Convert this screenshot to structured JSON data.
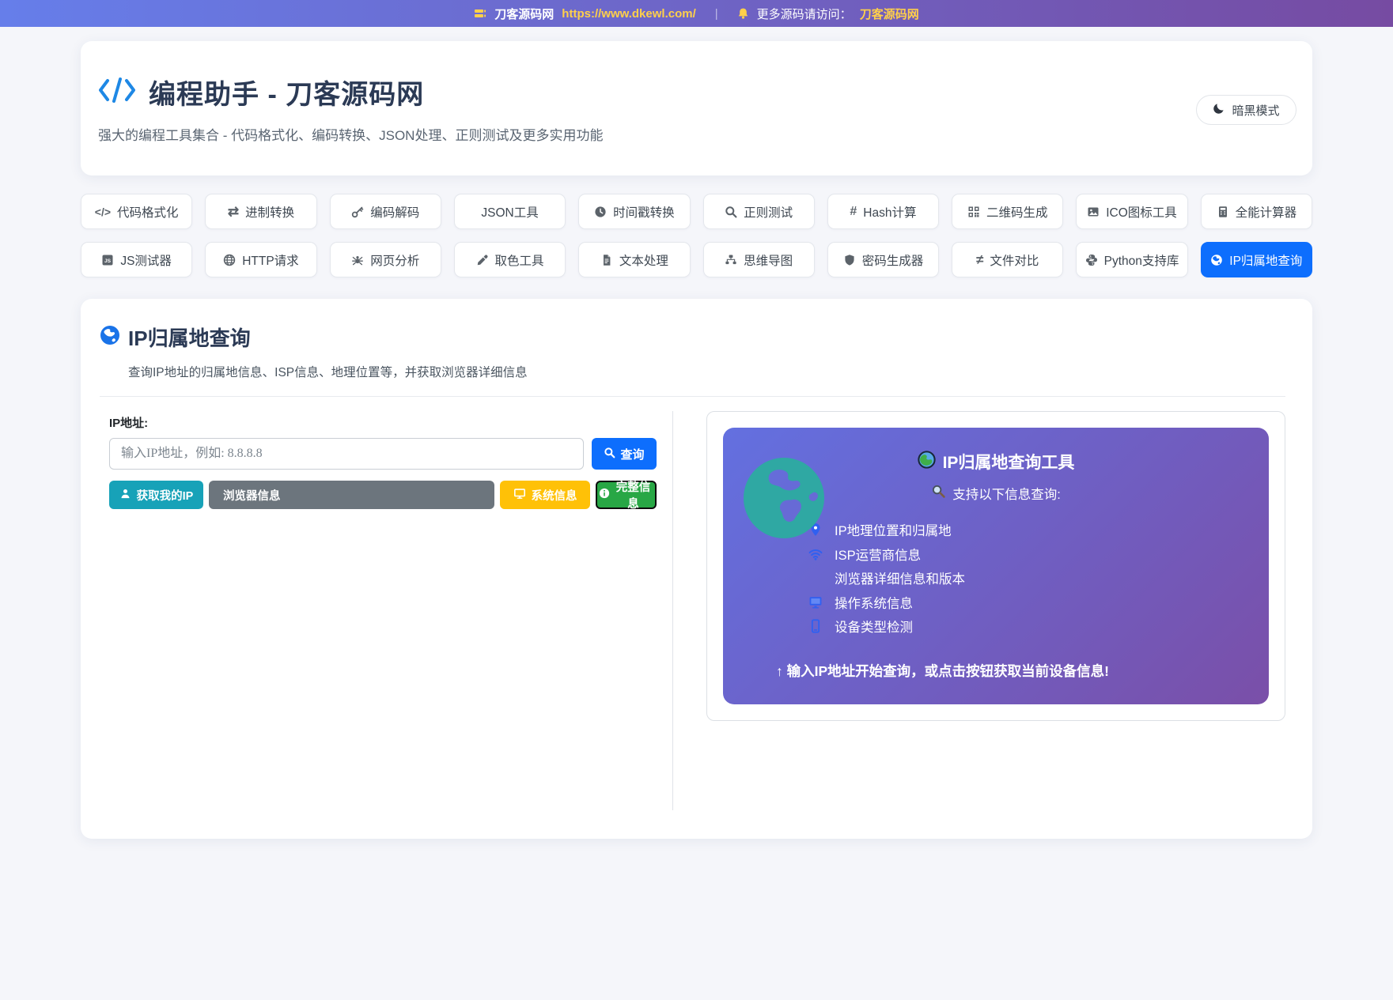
{
  "topbar": {
    "site_name": "刀客源码网",
    "url": "https://www.dkewl.com/",
    "divider": "|",
    "notice": "更多源码请访问：",
    "notice_link": "刀客源码网"
  },
  "header": {
    "title": "编程助手 - 刀客源码网",
    "subtitle": "强大的编程工具集合 - 代码格式化、编码转换、JSON处理、正则测试及更多实用功能",
    "dark_mode_label": "暗黑模式"
  },
  "nav": {
    "active": "IP归属地查询",
    "items": [
      {
        "label": "代码格式化",
        "glyph": "</>"
      },
      {
        "label": "进制转换",
        "glyph": "⇄"
      },
      {
        "label": "编码解码"
      },
      {
        "label": "JSON工具"
      },
      {
        "label": "时间戳转换"
      },
      {
        "label": "正则测试"
      },
      {
        "label": "Hash计算",
        "glyph": "#"
      },
      {
        "label": "二维码生成"
      },
      {
        "label": "ICO图标工具"
      },
      {
        "label": "全能计算器"
      },
      {
        "label": "JS测试器"
      },
      {
        "label": "HTTP请求"
      },
      {
        "label": "网页分析"
      },
      {
        "label": "取色工具"
      },
      {
        "label": "文本处理"
      },
      {
        "label": "思维导图"
      },
      {
        "label": "密码生成器"
      },
      {
        "label": "文件对比",
        "glyph": "≠"
      },
      {
        "label": "Python支持库"
      },
      {
        "label": "IP归属地查询"
      }
    ]
  },
  "tool": {
    "title": "IP归属地查询",
    "subtitle": "查询IP地址的归属地信息、ISP信息、地理位置等，并获取浏览器详细信息",
    "form": {
      "ip_label": "IP地址:",
      "ip_placeholder": "输入IP地址，例如: 8.8.8.8",
      "query_button": "查询",
      "my_ip_button": "获取我的IP",
      "browser_button": "浏览器信息",
      "system_button": "系统信息",
      "full_button": "完整信息"
    },
    "panel": {
      "title": "IP归属地查询工具",
      "subtitle": "支持以下信息查询:",
      "features": [
        "IP地理位置和归属地",
        "ISP运营商信息",
        "浏览器详细信息和版本",
        "操作系统信息",
        "设备类型检测"
      ],
      "hint": "↑ 输入IP地址开始查询，或点击按钮获取当前设备信息!"
    }
  },
  "colors": {
    "topbar_gradient": [
      "#667eea",
      "#764ba2"
    ],
    "accent": "#0d6efd",
    "teal": "#17a2b8",
    "gray": "#6c757d",
    "yellow": "#ffc107",
    "green": "#28a745",
    "panel_gradient": [
      "#6370e0",
      "#7a4fa8"
    ],
    "link_yellow": "#ffd04a"
  }
}
